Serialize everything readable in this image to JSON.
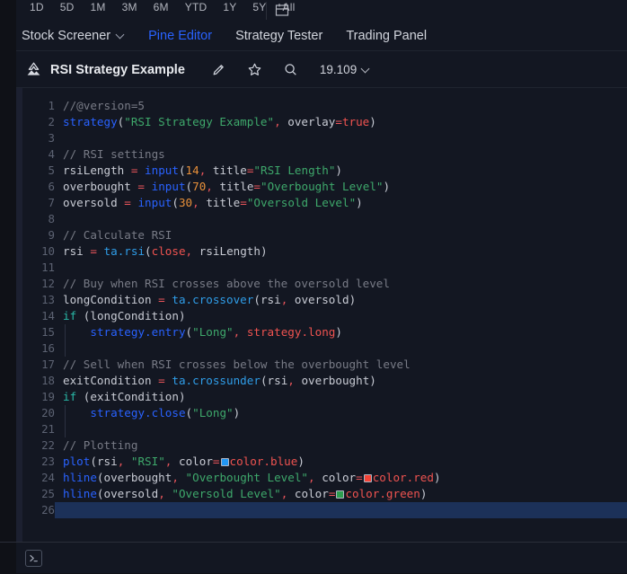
{
  "top_toolbar": {
    "ranges": [
      "1D",
      "5D",
      "1M",
      "3M",
      "6M",
      "YTD",
      "1Y",
      "5Y",
      "All"
    ],
    "calendar_icon": "calendar-icon"
  },
  "navbar": {
    "items": [
      {
        "label": "Stock Screener",
        "active": false,
        "has_chevron": true
      },
      {
        "label": "Pine Editor",
        "active": true,
        "has_chevron": false
      },
      {
        "label": "Strategy Tester",
        "active": false,
        "has_chevron": false
      },
      {
        "label": "Trading Panel",
        "active": false,
        "has_chevron": false
      }
    ]
  },
  "script_header": {
    "icon": "pine-script-icon",
    "title": "RSI Strategy Example",
    "actions": [
      {
        "name": "edit-icon",
        "label": "Edit"
      },
      {
        "name": "favorite-star-icon",
        "label": "Add to favorites"
      },
      {
        "name": "search-icon",
        "label": "Search"
      }
    ],
    "version": "19.109"
  },
  "editor": {
    "active_line": 26,
    "colors": {
      "background": "#131722",
      "comment": "#787b86",
      "keyword": "#2962ff",
      "string": "#3ea86b",
      "number": "#e8903a",
      "operator": "#e8545a",
      "builtin": "#ef5350",
      "conditional": "#29b9a8",
      "selection": "#1c3159"
    },
    "swatches": {
      "blue": "#2196f3",
      "red": "#f44336",
      "green": "#2e9e4f"
    },
    "lines": [
      {
        "n": 1,
        "text": "//@version=5"
      },
      {
        "n": 2,
        "text": "strategy(\"RSI Strategy Example\", overlay=true)"
      },
      {
        "n": 3,
        "text": ""
      },
      {
        "n": 4,
        "text": "// RSI settings"
      },
      {
        "n": 5,
        "text": "rsiLength = input(14, title=\"RSI Length\")"
      },
      {
        "n": 6,
        "text": "overbought = input(70, title=\"Overbought Level\")"
      },
      {
        "n": 7,
        "text": "oversold = input(30, title=\"Oversold Level\")"
      },
      {
        "n": 8,
        "text": ""
      },
      {
        "n": 9,
        "text": "// Calculate RSI"
      },
      {
        "n": 10,
        "text": "rsi = ta.rsi(close, rsiLength)"
      },
      {
        "n": 11,
        "text": ""
      },
      {
        "n": 12,
        "text": "// Buy when RSI crosses above the oversold level"
      },
      {
        "n": 13,
        "text": "longCondition = ta.crossover(rsi, oversold)"
      },
      {
        "n": 14,
        "text": "if (longCondition)"
      },
      {
        "n": 15,
        "text": "    strategy.entry(\"Long\", strategy.long)"
      },
      {
        "n": 16,
        "text": ""
      },
      {
        "n": 17,
        "text": "// Sell when RSI crosses below the overbought level"
      },
      {
        "n": 18,
        "text": "exitCondition = ta.crossunder(rsi, overbought)"
      },
      {
        "n": 19,
        "text": "if (exitCondition)"
      },
      {
        "n": 20,
        "text": "    strategy.close(\"Long\")"
      },
      {
        "n": 21,
        "text": ""
      },
      {
        "n": 22,
        "text": "// Plotting"
      },
      {
        "n": 23,
        "text": "plot(rsi, \"RSI\", color=color.blue)"
      },
      {
        "n": 24,
        "text": "hline(overbought, \"Overbought Level\", color=color.red)"
      },
      {
        "n": 25,
        "text": "hline(oversold, \"Oversold Level\", color=color.green)"
      },
      {
        "n": 26,
        "text": ""
      }
    ]
  },
  "console": {
    "terminal_icon": "terminal-icon"
  }
}
